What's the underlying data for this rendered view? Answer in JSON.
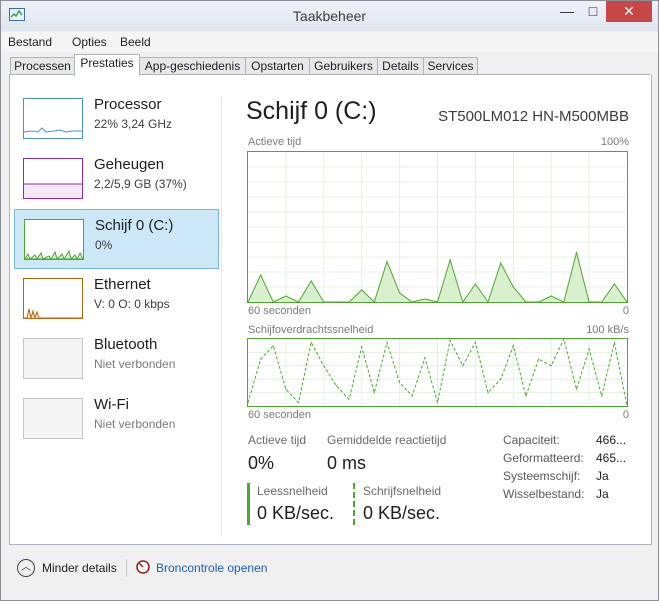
{
  "window": {
    "title": "Taakbeheer",
    "minimize": "—",
    "maximize": "□",
    "close": "✕",
    "app_icon": "task-manager-icon"
  },
  "menu": [
    "Bestand",
    "Opties",
    "Beeld"
  ],
  "tabs": [
    "Processen",
    "Prestaties",
    "App-geschiedenis",
    "Opstarten",
    "Gebruikers",
    "Details",
    "Services"
  ],
  "active_tab": "Prestaties",
  "sidebar": [
    {
      "title": "Processor",
      "subtitle": "22% 3,24 GHz",
      "color": "#4a90d9"
    },
    {
      "title": "Geheugen",
      "subtitle": "2,2/5,9 GB (37%)",
      "color": "#8b2bb5"
    },
    {
      "title": "Schijf 0 (C:)",
      "subtitle": "0%",
      "color": "#4ea72e"
    },
    {
      "title": "Ethernet",
      "subtitle": "V: 0 O: 0 kbps",
      "color": "#b8660f"
    },
    {
      "title": "Bluetooth",
      "subtitle": "Niet verbonden",
      "color": "#c6c6c6"
    },
    {
      "title": "Wi-Fi",
      "subtitle": "Niet verbonden",
      "color": "#c6c6c6"
    }
  ],
  "selected_index": 2,
  "main": {
    "title": "Schijf 0 (C:)",
    "device": "ST500LM012 HN-M500MBB",
    "chart1": {
      "label": "Actieve tijd",
      "max": "100%",
      "span": "60 seconden",
      "min": "0"
    },
    "chart2": {
      "label": "Schijfoverdrachtssnelheid",
      "max": "100 kB/s",
      "span": "60 seconden",
      "min": "0"
    },
    "stats": {
      "active_label": "Actieve tijd",
      "active_value": "0%",
      "resp_label": "Gemiddelde reactietijd",
      "resp_value": "0 ms",
      "read_label": "Leessnelheid",
      "read_value": "0 KB/sec.",
      "write_label": "Schrijfsnelheid",
      "write_value": "0 KB/sec."
    },
    "properties": [
      {
        "key": "Capaciteit:",
        "value": "466..."
      },
      {
        "key": "Geformatteerd:",
        "value": "465..."
      },
      {
        "key": "Systeemschijf:",
        "value": "Ja"
      },
      {
        "key": "Wisselbestand:",
        "value": "Ja"
      }
    ]
  },
  "footer": {
    "less": "Minder details",
    "resmon": "Broncontrole openen"
  },
  "colors": {
    "disk_green": "#4ea72e",
    "disk_fill": "#d9f0cf",
    "grid": "#e4f1de",
    "selected_bg": "#cce8f6"
  },
  "chart_data": [
    {
      "type": "area",
      "title": "Actieve tijd",
      "xlabel": "60 seconden",
      "ylabel": "",
      "ylim": [
        0,
        100
      ],
      "x": [
        60,
        58,
        56,
        54,
        52,
        50,
        48,
        46,
        44,
        42,
        40,
        38,
        36,
        34,
        32,
        30,
        28,
        26,
        24,
        22,
        20,
        18,
        16,
        14,
        12,
        10,
        8,
        6,
        4,
        2,
        0
      ],
      "series": [
        {
          "values": [
            0,
            18,
            0,
            4,
            0,
            14,
            0,
            0,
            0,
            8,
            0,
            27,
            6,
            0,
            2,
            0,
            28,
            0,
            12,
            0,
            26,
            10,
            0,
            0,
            4,
            0,
            33,
            0,
            0,
            12,
            0
          ]
        }
      ]
    },
    {
      "type": "line",
      "title": "Schijfoverdrachtssnelheid",
      "xlabel": "60 seconden",
      "ylabel": "",
      "ylim": [
        0,
        100
      ],
      "x": [
        60,
        58,
        56,
        54,
        52,
        50,
        48,
        46,
        44,
        42,
        40,
        38,
        36,
        34,
        32,
        30,
        28,
        26,
        24,
        22,
        20,
        18,
        16,
        14,
        12,
        10,
        8,
        6,
        4,
        2,
        0
      ],
      "series": [
        {
          "values": [
            5,
            70,
            90,
            25,
            5,
            95,
            60,
            30,
            10,
            88,
            20,
            95,
            35,
            15,
            72,
            5,
            98,
            60,
            95,
            20,
            40,
            90,
            15,
            70,
            60,
            100,
            25,
            85,
            15,
            95,
            0
          ]
        }
      ]
    }
  ]
}
